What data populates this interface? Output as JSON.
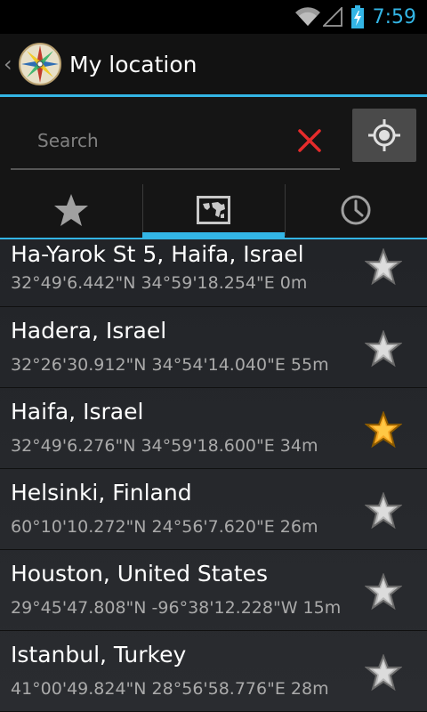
{
  "status_bar": {
    "time": "7:59"
  },
  "action_bar": {
    "title": "My location"
  },
  "search": {
    "placeholder": "Search",
    "value": ""
  },
  "tabs": [
    {
      "name": "favorites",
      "icon": "star-icon",
      "selected": false
    },
    {
      "name": "map",
      "icon": "map-icon",
      "selected": true
    },
    {
      "name": "history",
      "icon": "clock-icon",
      "selected": false
    }
  ],
  "colors": {
    "accent": "#33b5e5",
    "favorite": "#f5a623"
  },
  "locations": [
    {
      "name": "Ha-Yarok St 5, Haifa, Israel",
      "coords": "32°49'6.442\"N 34°59'18.254\"E 0m",
      "favorite": false
    },
    {
      "name": "Hadera, Israel",
      "coords": "32°26'30.912\"N 34°54'14.040\"E 55m",
      "favorite": false
    },
    {
      "name": "Haifa, Israel",
      "coords": "32°49'6.276\"N 34°59'18.600\"E 34m",
      "favorite": true
    },
    {
      "name": "Helsinki, Finland",
      "coords": "60°10'10.272\"N 24°56'7.620\"E 26m",
      "favorite": false
    },
    {
      "name": "Houston, United States",
      "coords": "29°45'47.808\"N -96°38'12.228\"W 15m",
      "favorite": false
    },
    {
      "name": "Istanbul, Turkey",
      "coords": "41°00'49.824\"N 28°56'58.776\"E 28m",
      "favorite": false
    }
  ]
}
